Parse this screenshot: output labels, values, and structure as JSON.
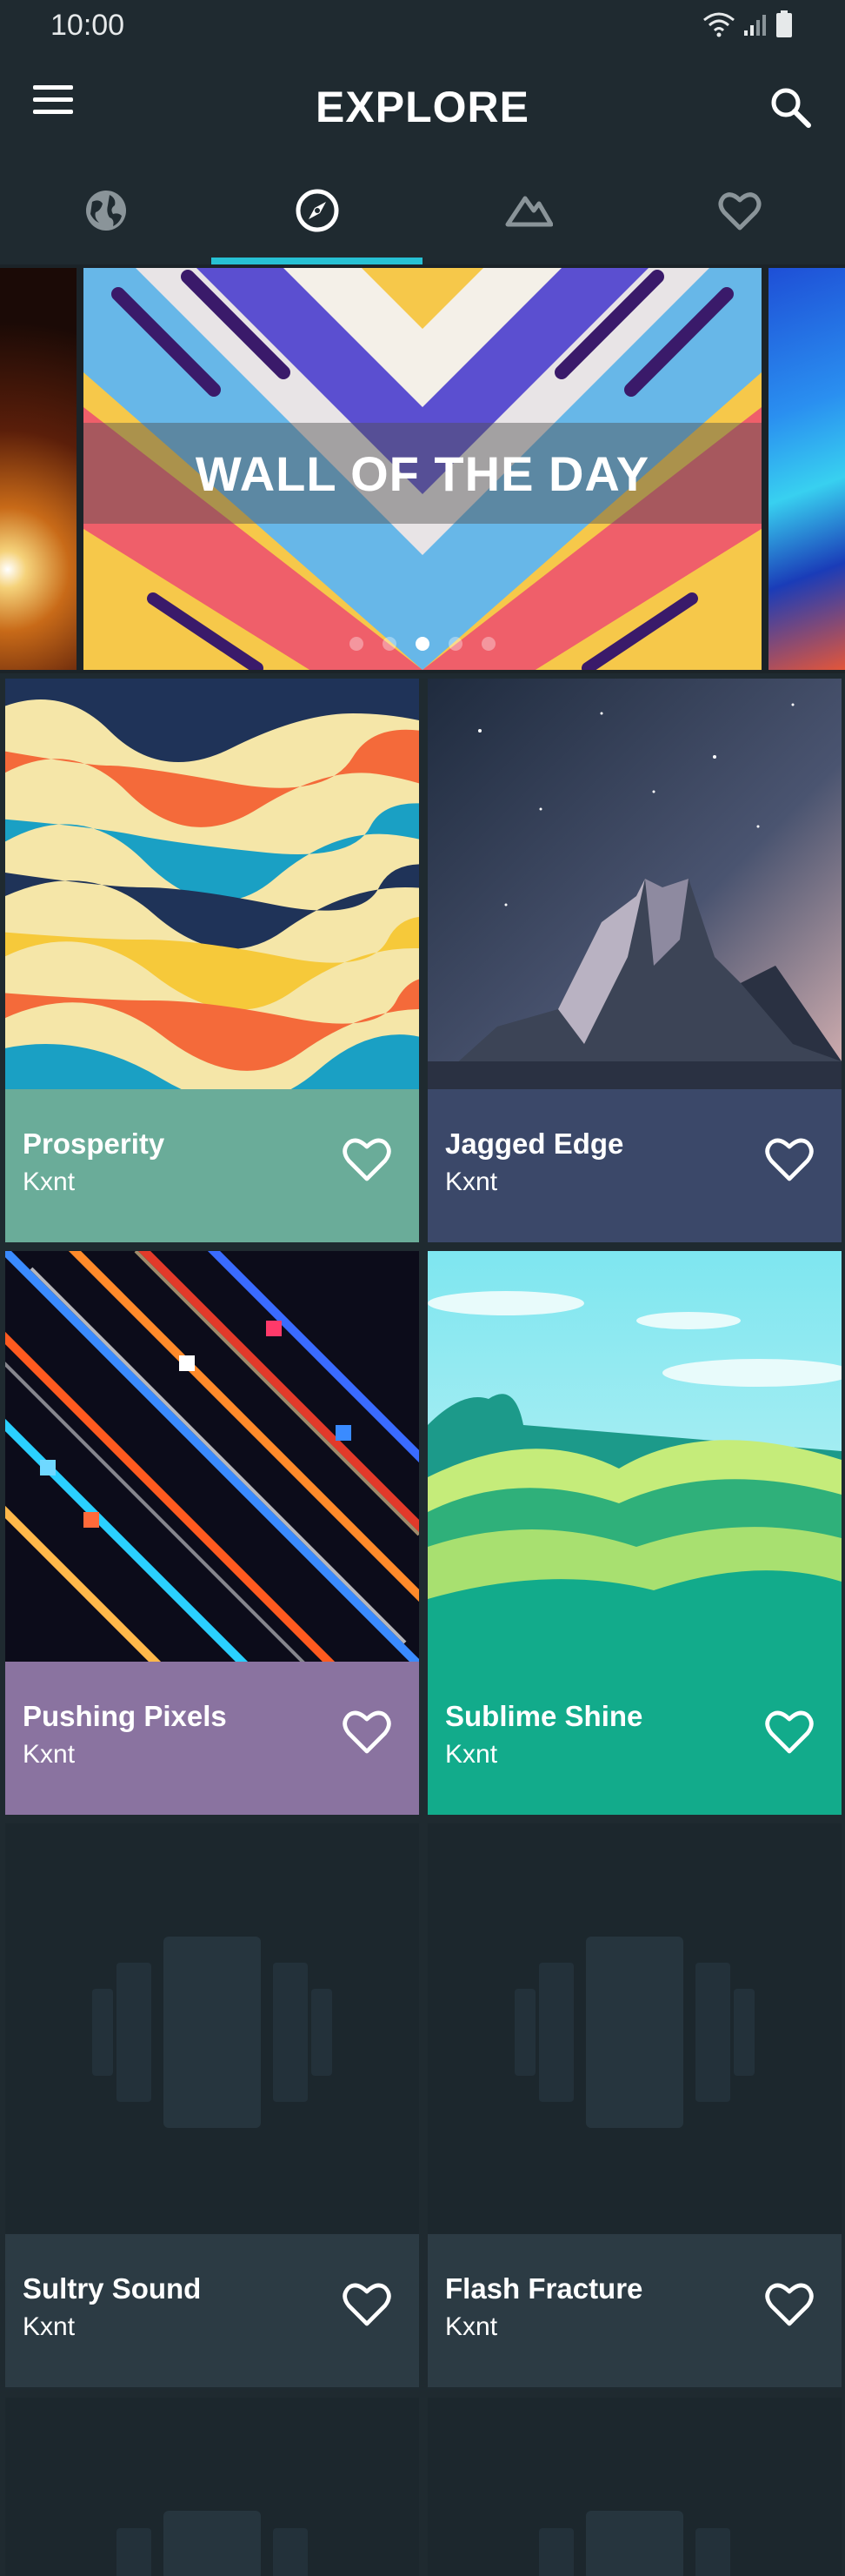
{
  "status": {
    "time": "10:00"
  },
  "app_bar": {
    "title": "EXPLORE"
  },
  "tabs": [
    {
      "name": "world",
      "icon": "globe-icon",
      "active": false
    },
    {
      "name": "explore",
      "icon": "compass-icon",
      "active": true
    },
    {
      "name": "collections",
      "icon": "mountain-icon",
      "active": false
    },
    {
      "name": "favorites",
      "icon": "heart-icon",
      "active": false
    }
  ],
  "carousel": {
    "banner": "WALL OF THE DAY",
    "dots": 5,
    "active_dot": 3
  },
  "wallpapers": [
    {
      "title": "Prosperity",
      "author": "Kxnt",
      "color": "#6aac99"
    },
    {
      "title": "Jagged Edge",
      "author": "Kxnt",
      "color": "#3b4869"
    },
    {
      "title": "Pushing Pixels",
      "author": "Kxnt",
      "color": "#8a73a0"
    },
    {
      "title": "Sublime Shine",
      "author": "Kxnt",
      "color": "#12ab8b"
    },
    {
      "title": "Sultry Sound",
      "author": "Kxnt",
      "color": "#2c3b44"
    },
    {
      "title": "Flash Fracture",
      "author": "Kxnt",
      "color": "#2c3b44"
    }
  ],
  "colors": {
    "accent": "#27c1d4",
    "background": "#1f2a30"
  }
}
